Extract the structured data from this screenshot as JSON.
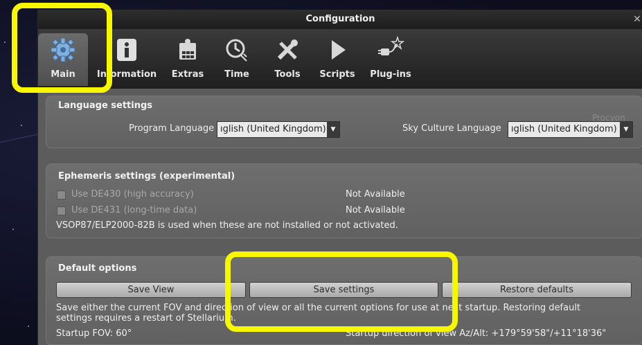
{
  "window": {
    "title": "Configuration",
    "close_glyph": "✕"
  },
  "tabs": [
    {
      "label": "Main",
      "icon": "gear-icon",
      "active": true
    },
    {
      "label": "Information",
      "icon": "info-icon"
    },
    {
      "label": "Extras",
      "icon": "extras-puzzle-icon"
    },
    {
      "label": "Time",
      "icon": "clock-icon"
    },
    {
      "label": "Tools",
      "icon": "tools-icon"
    },
    {
      "label": "Scripts",
      "icon": "play-icon"
    },
    {
      "label": "Plug-ins",
      "icon": "plug-icon"
    }
  ],
  "language": {
    "title": "Language settings",
    "program_label": "Program Language",
    "program_value": "ıglish (United Kingdom)",
    "sky_label": "Sky Culture Language",
    "sky_value": "ıglish (United Kingdom)",
    "watermark": "Procyon"
  },
  "ephemeris": {
    "title": "Ephemeris settings (experimental)",
    "de430_label": "Use DE430 (high accuracy)",
    "de430_status": "Not Available",
    "de431_label": "Use DE431 (long-time data)",
    "de431_status": "Not Available",
    "note": "VSOP87/ELP2000-82B is used when these are not installed or not activated."
  },
  "defaults": {
    "title": "Default options",
    "save_view": "Save View",
    "save_settings": "Save settings",
    "restore_defaults": "Restore defaults",
    "description_line1": "Save either the current FOV and direction of view or all the current options for use at next startup. Restoring default",
    "description_line2": "settings requires a restart of Stellarium.",
    "startup_fov": "Startup FOV: 60°",
    "startup_direction": "Startup direction of view Az/Alt: +179°59'58\"/+11°18'36\""
  },
  "colors": {
    "highlight": "#f7f700",
    "panel": "#5d5d5d"
  }
}
